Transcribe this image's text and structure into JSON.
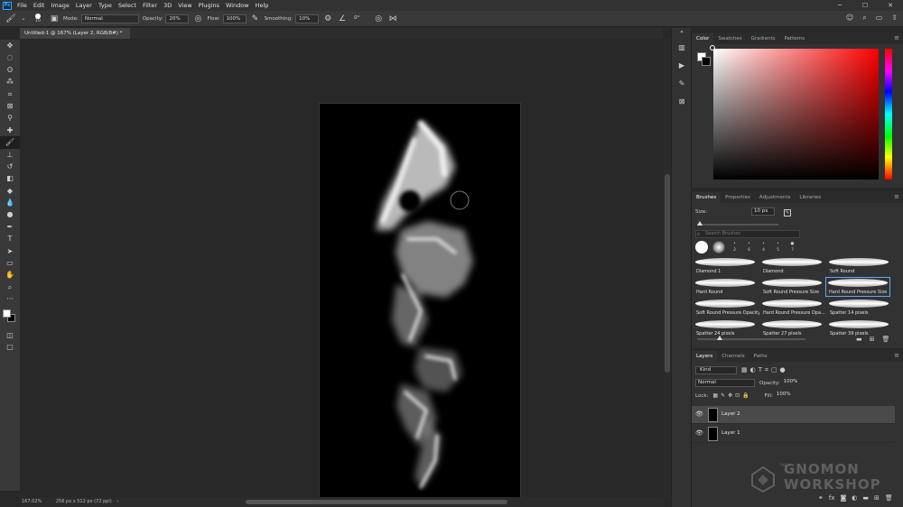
{
  "app": {
    "logo": "Ps"
  },
  "menu": [
    "File",
    "Edit",
    "Image",
    "Layer",
    "Type",
    "Select",
    "Filter",
    "3D",
    "View",
    "Plugins",
    "Window",
    "Help"
  ],
  "options": {
    "brush_size": "10",
    "mode_label": "Mode:",
    "mode_value": "Normal",
    "opacity_label": "Opacity:",
    "opacity_value": "20%",
    "flow_label": "Flow:",
    "flow_value": "100%",
    "smoothing_label": "Smoothing:",
    "smoothing_value": "10%",
    "angle_value": "0°"
  },
  "document": {
    "tab_title": "Untitled-1 @ 167% (Layer 2, RGB/8#) *",
    "zoom_status": "167.02%",
    "size_status": "256 px x 512 px (72 ppi)"
  },
  "color_panel": {
    "tabs": [
      "Color",
      "Swatches",
      "Gradients",
      "Patterns"
    ],
    "hue": "#ff0000"
  },
  "brushes_panel": {
    "tabs": [
      "Brushes",
      "Properties",
      "Adjustments",
      "Libraries"
    ],
    "size_label": "Size:",
    "size_value": "10 px",
    "search_placeholder": "Search Brushes",
    "tip_numbers": [
      "2",
      "6",
      "4",
      "5",
      "7"
    ],
    "presets": [
      "Diamond 1",
      "Diamond",
      "Soft Round",
      "Hard Round",
      "Soft Round Pressure Size",
      "Hard Round Pressure Size",
      "Soft Round Pressure Opacity",
      "Hard Round Pressure Opa...",
      "Spatter 14 pixels",
      "Spatter 24 pixels",
      "Spatter 27 pixels",
      "Spatter 39 pixels"
    ],
    "selected_preset": "Hard Round Pressure Size"
  },
  "layers_panel": {
    "tabs": [
      "Layers",
      "Channels",
      "Paths"
    ],
    "filter_kind": "Kind",
    "blend_mode": "Normal",
    "opacity_label": "Opacity:",
    "opacity_value": "100%",
    "lock_label": "Lock:",
    "fill_label": "Fill:",
    "fill_value": "100%",
    "layers": [
      {
        "name": "Layer 2",
        "selected": true
      },
      {
        "name": "Layer 1",
        "selected": false
      }
    ]
  },
  "watermark": {
    "line1": "THE",
    "line2": "GNOMON",
    "line3": "WORKSHOP"
  }
}
